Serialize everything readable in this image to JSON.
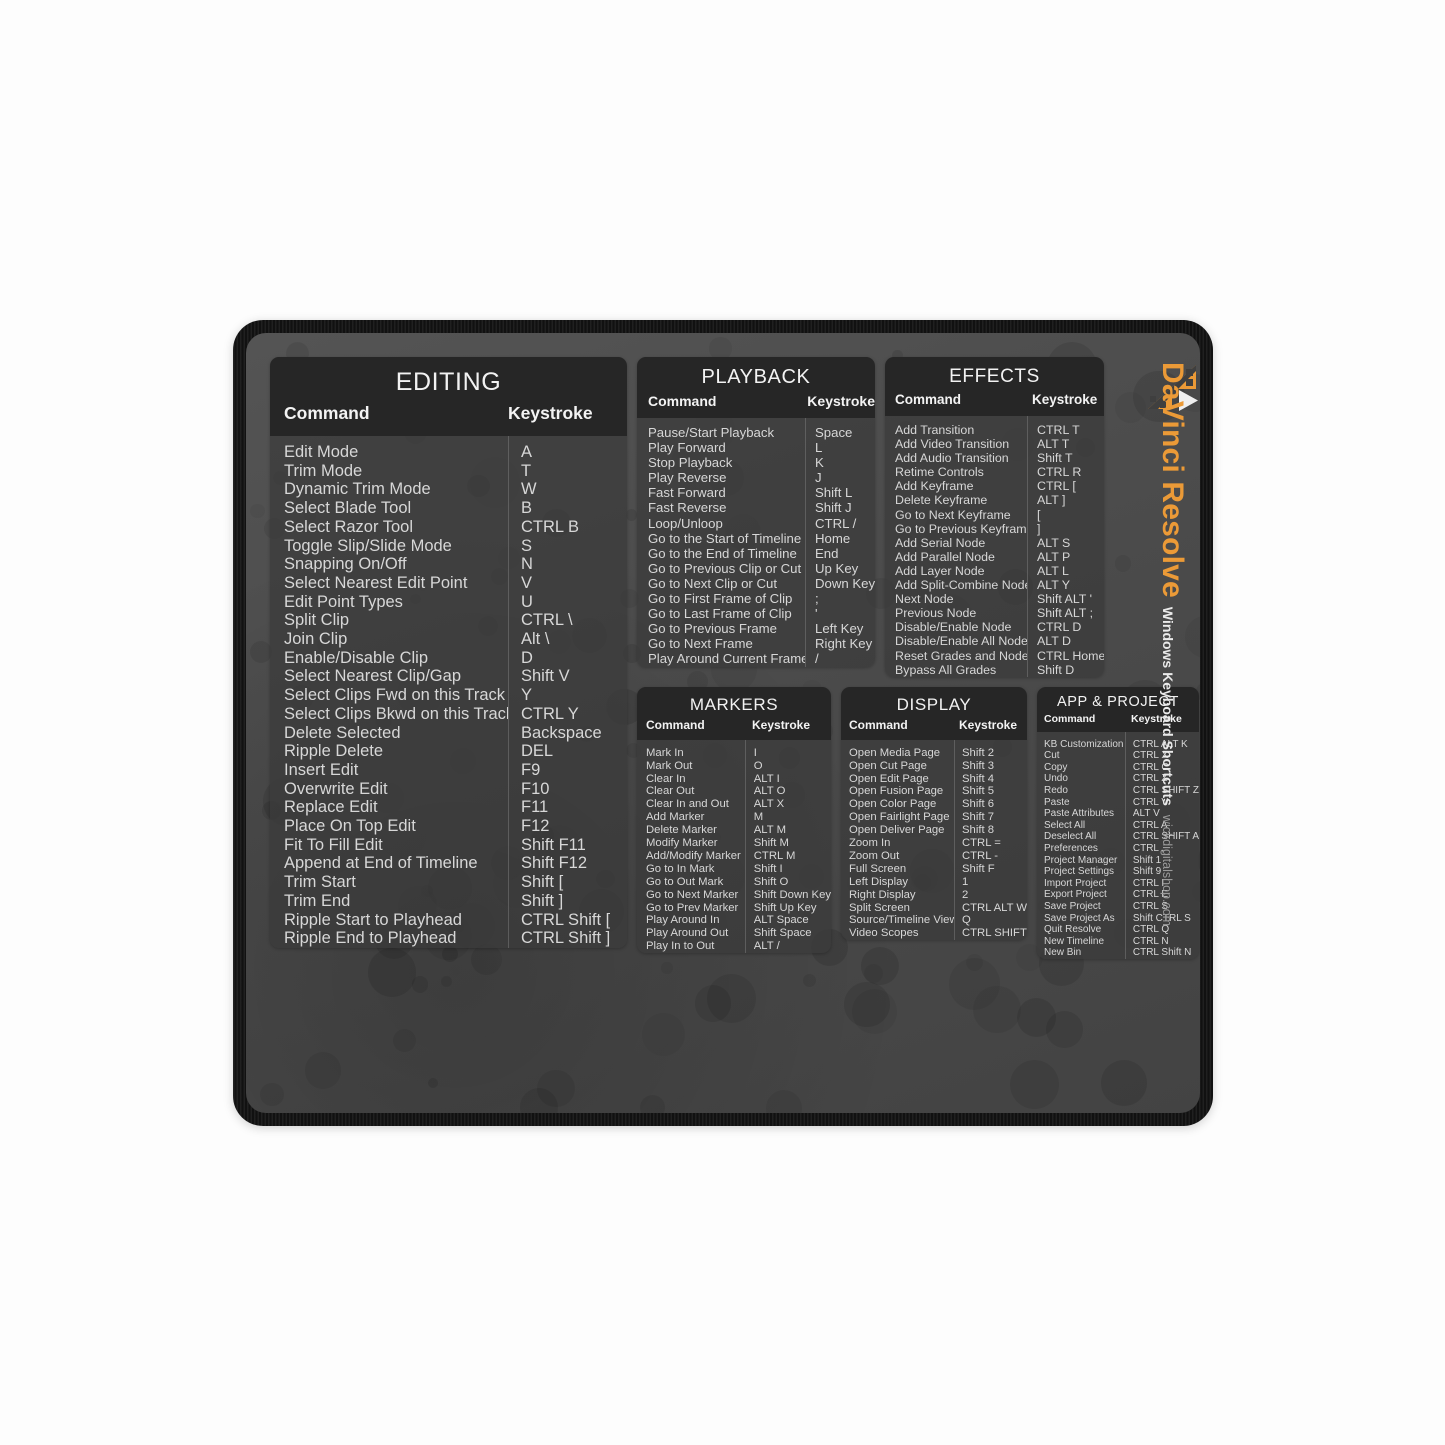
{
  "brand": {
    "title": "DaVinci Resolve",
    "subtitle": "Windows Keyboard Shortcuts",
    "website": "wickdigitalshop.com",
    "logo_icon": "film-strip-play-icon",
    "accent_color": "#eb9a37",
    "pad_color": "#4c4c4c",
    "card_header_color": "#262626"
  },
  "columns": {
    "command": "Command",
    "keystroke": "Keystroke"
  },
  "cards": {
    "editing": {
      "title": "EDITING",
      "rows": [
        {
          "command": "Edit Mode",
          "key": "A"
        },
        {
          "command": "Trim Mode",
          "key": "T"
        },
        {
          "command": "Dynamic Trim Mode",
          "key": "W"
        },
        {
          "command": "Select Blade Tool",
          "key": "B"
        },
        {
          "command": "Select Razor Tool",
          "key": "CTRL  B"
        },
        {
          "command": "Toggle Slip/Slide Mode",
          "key": "S"
        },
        {
          "command": "Snapping On/Off",
          "key": "N"
        },
        {
          "command": "Select Nearest Edit Point",
          "key": "V"
        },
        {
          "command": "Edit Point Types",
          "key": "U"
        },
        {
          "command": "Split Clip",
          "key": "CTRL  \\"
        },
        {
          "command": "Join Clip",
          "key": "Alt  \\"
        },
        {
          "command": "Enable/Disable Clip",
          "key": "D"
        },
        {
          "command": "Select Nearest Clip/Gap",
          "key": "Shift  V"
        },
        {
          "command": "Select Clips Fwd on this Track",
          "key": "Y"
        },
        {
          "command": "Select Clips Bkwd on this Track",
          "key": "CTRL  Y"
        },
        {
          "command": "Delete Selected",
          "key": "Backspace"
        },
        {
          "command": "Ripple Delete",
          "key": "DEL"
        },
        {
          "command": "Insert Edit",
          "key": "F9"
        },
        {
          "command": "Overwrite Edit",
          "key": "F10"
        },
        {
          "command": "Replace Edit",
          "key": "F11"
        },
        {
          "command": "Place On Top Edit",
          "key": "F12"
        },
        {
          "command": "Fit To Fill Edit",
          "key": "Shift  F11"
        },
        {
          "command": "Append at End of Timeline",
          "key": "Shift  F12"
        },
        {
          "command": "Trim Start",
          "key": "Shift  ["
        },
        {
          "command": "Trim End",
          "key": "Shift  ]"
        },
        {
          "command": "Ripple Start to Playhead",
          "key": "CTRL  Shift  ["
        },
        {
          "command": "Ripple End to Playhead",
          "key": "CTRL  Shift  ]"
        }
      ]
    },
    "playback": {
      "title": "PLAYBACK",
      "rows": [
        {
          "command": "Pause/Start Playback",
          "key": "Space"
        },
        {
          "command": "Play Forward",
          "key": "L"
        },
        {
          "command": "Stop Playback",
          "key": "K"
        },
        {
          "command": "Play Reverse",
          "key": "J"
        },
        {
          "command": "Fast Forward",
          "key": "Shift  L"
        },
        {
          "command": "Fast Reverse",
          "key": "Shift  J"
        },
        {
          "command": "Loop/Unloop",
          "key": "CTRL  /"
        },
        {
          "command": "Go to the Start of Timeline",
          "key": "Home"
        },
        {
          "command": "Go to the End of Timeline",
          "key": "End"
        },
        {
          "command": "Go to Previous Clip or Cut",
          "key": "Up Key"
        },
        {
          "command": "Go to Next Clip or Cut",
          "key": "Down Key"
        },
        {
          "command": "Go to First Frame of Clip",
          "key": ";"
        },
        {
          "command": "Go to Last Frame of Clip",
          "key": "'"
        },
        {
          "command": "Go to Previous Frame",
          "key": "Left Key"
        },
        {
          "command": "Go to Next Frame",
          "key": "Right Key"
        },
        {
          "command": "Play Around Current Frame",
          "key": "/"
        }
      ]
    },
    "effects": {
      "title": "EFFECTS",
      "rows": [
        {
          "command": "Add Transition",
          "key": "CTRL  T"
        },
        {
          "command": "Add Video Transition",
          "key": "ALT  T"
        },
        {
          "command": "Add Audio Transition",
          "key": "Shift  T"
        },
        {
          "command": "Retime Controls",
          "key": "CTRL  R"
        },
        {
          "command": "Add Keyframe",
          "key": "CTRL  ["
        },
        {
          "command": "Delete Keyframe",
          "key": "ALT  ]"
        },
        {
          "command": "Go to Next Keyframe",
          "key": "["
        },
        {
          "command": "Go to Previous Keyframe",
          "key": "]"
        },
        {
          "command": "Add Serial Node",
          "key": "ALT  S"
        },
        {
          "command": "Add Parallel Node",
          "key": "ALT  P"
        },
        {
          "command": "Add Layer Node",
          "key": "ALT  L"
        },
        {
          "command": "Add Split-Combine Node",
          "key": "ALT  Y"
        },
        {
          "command": "Next Node",
          "key": "Shift  ALT  '"
        },
        {
          "command": "Previous Node",
          "key": "Shift  ALT  ;"
        },
        {
          "command": "Disable/Enable Node",
          "key": "CTRL  D"
        },
        {
          "command": "Disable/Enable All Nodes",
          "key": "ALT  D"
        },
        {
          "command": "Reset Grades and Nodes",
          "key": "CTRL  Home"
        },
        {
          "command": "Bypass All Grades",
          "key": "Shift  D"
        }
      ]
    },
    "markers": {
      "title": "MARKERS",
      "rows": [
        {
          "command": "Mark In",
          "key": "I"
        },
        {
          "command": "Mark Out",
          "key": "O"
        },
        {
          "command": "Clear In",
          "key": "ALT  I"
        },
        {
          "command": "Clear Out",
          "key": "ALT  O"
        },
        {
          "command": "Clear In and Out",
          "key": "ALT  X"
        },
        {
          "command": "Add Marker",
          "key": "M"
        },
        {
          "command": "Delete Marker",
          "key": "ALT  M"
        },
        {
          "command": "Modify Marker",
          "key": "Shift  M"
        },
        {
          "command": "Add/Modify Marker",
          "key": "CTRL  M"
        },
        {
          "command": "Go to In Mark",
          "key": "Shift  I"
        },
        {
          "command": "Go to Out Mark",
          "key": "Shift  O"
        },
        {
          "command": "Go to Next Marker",
          "key": "Shift  Down Key"
        },
        {
          "command": "Go to Prev Marker",
          "key": "Shift  Up Key"
        },
        {
          "command": "Play Around In",
          "key": "ALT  Space"
        },
        {
          "command": "Play Around Out",
          "key": "Shift  Space"
        },
        {
          "command": "Play In to Out",
          "key": "ALT  /"
        }
      ]
    },
    "display": {
      "title": "DISPLAY",
      "rows": [
        {
          "command": "Open Media Page",
          "key": "Shift  2"
        },
        {
          "command": "Open Cut Page",
          "key": "Shift  3"
        },
        {
          "command": "Open Edit Page",
          "key": "Shift  4"
        },
        {
          "command": "Open Fusion Page",
          "key": "Shift  5"
        },
        {
          "command": "Open Color Page",
          "key": "Shift  6"
        },
        {
          "command": "Open Fairlight Page",
          "key": "Shift  7"
        },
        {
          "command": "Open Deliver Page",
          "key": "Shift  8"
        },
        {
          "command": "Zoom In",
          "key": "CTRL  ="
        },
        {
          "command": "Zoom Out",
          "key": "CTRL  -"
        },
        {
          "command": "Full Screen",
          "key": "Shift  F"
        },
        {
          "command": "Left Display",
          "key": "1"
        },
        {
          "command": "Right Display",
          "key": "2"
        },
        {
          "command": "Split Screen",
          "key": "CTRL  ALT  W"
        },
        {
          "command": "Source/Timeline Viewer",
          "key": "Q"
        },
        {
          "command": "Video Scopes",
          "key": "CTRL  SHIFT  W"
        }
      ]
    },
    "app_project": {
      "title": "APP & PROJECT",
      "rows": [
        {
          "command": "KB Customization",
          "key": "CTRL  ALT  K"
        },
        {
          "command": "Cut",
          "key": "CTRL  X"
        },
        {
          "command": "Copy",
          "key": "CTRL  C"
        },
        {
          "command": "Undo",
          "key": "CTRL  Z"
        },
        {
          "command": "Redo",
          "key": "CTRL  SHIFT  Z"
        },
        {
          "command": "Paste",
          "key": "CTRL  V"
        },
        {
          "command": "Paste Attributes",
          "key": "ALT  V"
        },
        {
          "command": "Select All",
          "key": "CTRL  A"
        },
        {
          "command": "Deselect All",
          "key": "CTRL  SHIFT  A"
        },
        {
          "command": "Preferences",
          "key": "CTRL  ,"
        },
        {
          "command": "Project Manager",
          "key": "Shift  1"
        },
        {
          "command": "Project Settings",
          "key": "Shift  9"
        },
        {
          "command": "Import Project",
          "key": "CTRL  I"
        },
        {
          "command": "Export Project",
          "key": "CTRL  E"
        },
        {
          "command": "Save Project",
          "key": "CTRL  S"
        },
        {
          "command": "Save Project As",
          "key": "Shift  CTRL  S"
        },
        {
          "command": "Quit Resolve",
          "key": "CTRL  Q"
        },
        {
          "command": "New Timeline",
          "key": "CTRL  N"
        },
        {
          "command": "New Bin",
          "key": "CTRL  Shift  N"
        }
      ]
    }
  }
}
